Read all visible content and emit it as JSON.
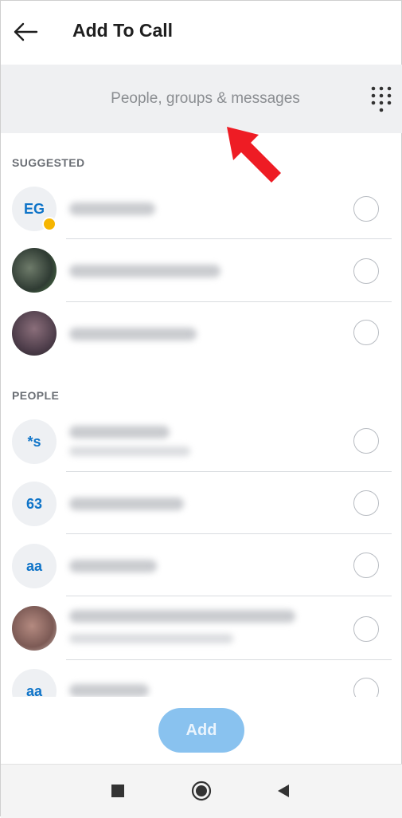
{
  "header": {
    "title": "Add To Call",
    "back_icon": "arrow-left-icon"
  },
  "search": {
    "placeholder": "People, groups & messages",
    "dialpad_icon": "dialpad-icon"
  },
  "sections": {
    "suggested": "SUGGESTED",
    "people": "PEOPLE"
  },
  "suggested": [
    {
      "initials": "EG",
      "has_photo": false,
      "presence": "away"
    },
    {
      "initials": "",
      "has_photo": true
    },
    {
      "initials": "",
      "has_photo": true
    }
  ],
  "people": [
    {
      "initials": "*s",
      "has_photo": false
    },
    {
      "initials": "63",
      "has_photo": false
    },
    {
      "initials": "aa",
      "has_photo": false
    },
    {
      "initials": "",
      "has_photo": true
    },
    {
      "initials": "aa",
      "has_photo": false
    }
  ],
  "add_button": {
    "label": "Add"
  },
  "nav": {
    "recents_icon": "square-icon",
    "home_icon": "circle-home-icon",
    "back_icon": "triangle-back-icon"
  },
  "colors": {
    "accent": "#0f74c8",
    "search_bg": "#eff0f2",
    "add_button": "#89c2ef",
    "presence_away": "#f6b500",
    "annotation_arrow": "#ee1c24"
  }
}
